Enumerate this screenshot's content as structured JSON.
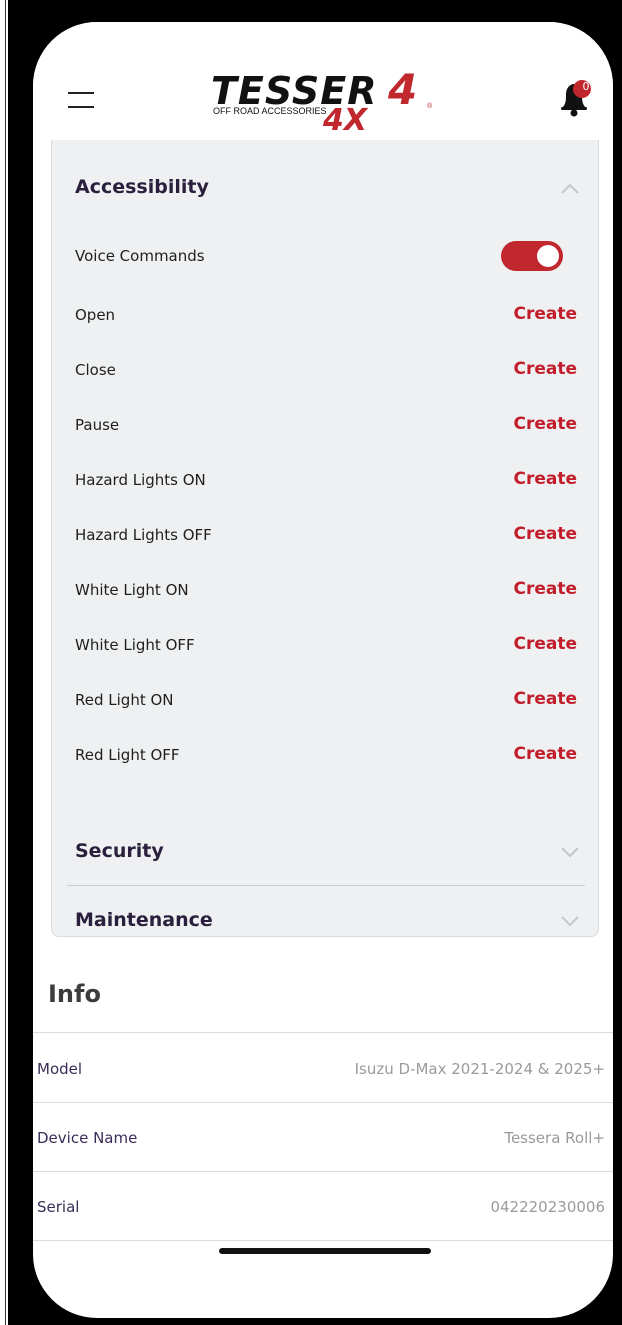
{
  "header": {
    "logo_main": "TESSER4",
    "logo_sub": "OFF ROAD ACCESSORIES",
    "logo_badge": "4X",
    "notification_count": "0"
  },
  "accessibility": {
    "title": "Accessibility",
    "voice_commands_label": "Voice Commands",
    "voice_commands_on": true,
    "commands": [
      {
        "label": "Open",
        "action": "Create"
      },
      {
        "label": "Close",
        "action": "Create"
      },
      {
        "label": "Pause",
        "action": "Create"
      },
      {
        "label": "Hazard Lights ON",
        "action": "Create"
      },
      {
        "label": "Hazard Lights OFF",
        "action": "Create"
      },
      {
        "label": "White Light ON",
        "action": "Create"
      },
      {
        "label": "White Light OFF",
        "action": "Create"
      },
      {
        "label": "Red Light ON",
        "action": "Create"
      },
      {
        "label": "Red Light OFF",
        "action": "Create"
      }
    ]
  },
  "security": {
    "title": "Security"
  },
  "maintenance": {
    "title": "Maintenance"
  },
  "info": {
    "title": "Info",
    "rows": [
      {
        "label": "Model",
        "value": "Isuzu D-Max 2021-2024 & 2025+"
      },
      {
        "label": "Device Name",
        "value": "Tessera Roll+"
      },
      {
        "label": "Serial",
        "value": "042220230006"
      }
    ]
  },
  "colors": {
    "accent_red": "#c21d2b",
    "heading_purple": "#2a1f3d",
    "card_bg": "#eef0f1"
  },
  "icons": {
    "menu": "hamburger-icon",
    "notifications": "bell-icon",
    "expand": "chevron-up-icon",
    "collapse": "chevron-down-icon"
  }
}
